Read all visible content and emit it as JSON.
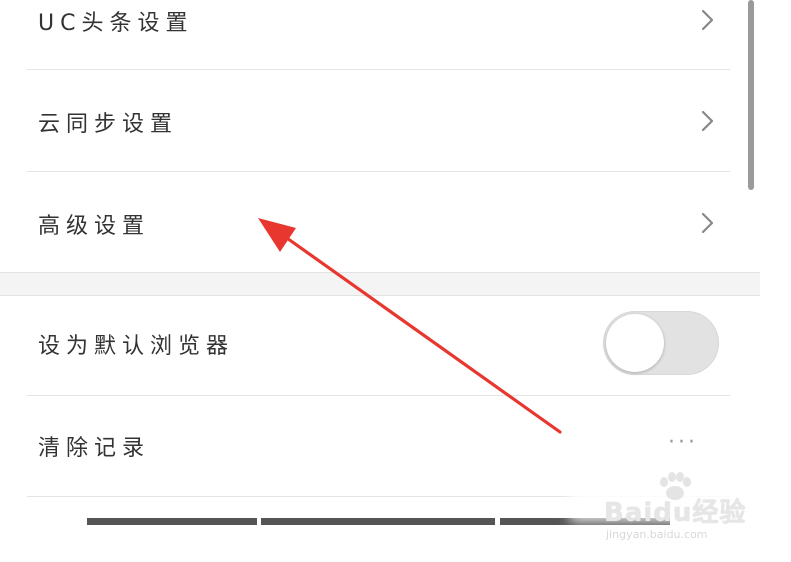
{
  "settings": {
    "items": [
      {
        "label": "UC头条设置",
        "has_chevron": true
      },
      {
        "label": "云同步设置",
        "has_chevron": true
      },
      {
        "label": "高级设置",
        "has_chevron": true
      },
      {
        "label": "设为默认浏览器",
        "has_chevron": false,
        "toggle": "off"
      },
      {
        "label": "清除记录",
        "has_chevron": false,
        "trailing": "···"
      }
    ]
  },
  "annotation": {
    "arrow_color": "#e8372f",
    "points_to": "高级设置"
  },
  "watermark": {
    "brand": "Baidu经验",
    "url": "jingyan.baidu.com"
  },
  "colors": {
    "background": "#ffffff",
    "divider": "#e4e4e4",
    "section_gap": "#f4f4f4",
    "toggle_off": "#e2e2e2",
    "text": "#333333",
    "chevron": "#888888"
  }
}
